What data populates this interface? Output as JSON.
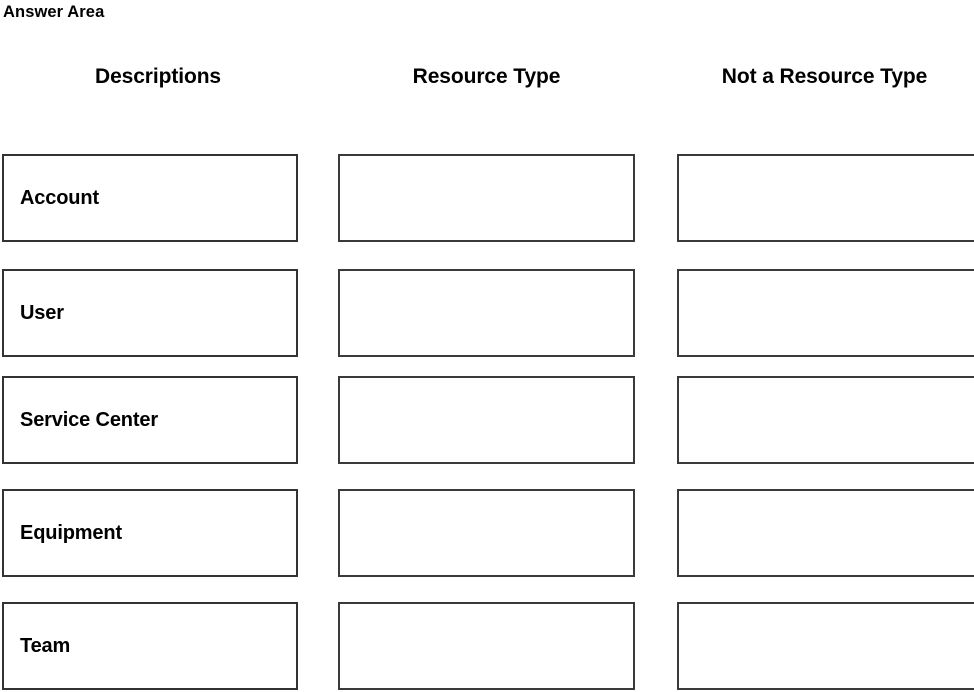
{
  "page": {
    "title": "Answer Area",
    "background_color": "#ffffff",
    "text_color": "#000000",
    "box_border_color": "#333333"
  },
  "columns": [
    {
      "id": "descriptions",
      "header": "Descriptions"
    },
    {
      "id": "resource-type",
      "header": "Resource Type"
    },
    {
      "id": "not-a-resource-type",
      "header": "Not a Resource Type"
    }
  ],
  "rows": [
    {
      "description": "Account",
      "resource_type_value": "",
      "not_a_resource_type_value": ""
    },
    {
      "description": "User",
      "resource_type_value": "",
      "not_a_resource_type_value": ""
    },
    {
      "description": "Service Center",
      "resource_type_value": "",
      "not_a_resource_type_value": ""
    },
    {
      "description": "Equipment",
      "resource_type_value": "",
      "not_a_resource_type_value": ""
    },
    {
      "description": "Team",
      "resource_type_value": "",
      "not_a_resource_type_value": ""
    }
  ]
}
